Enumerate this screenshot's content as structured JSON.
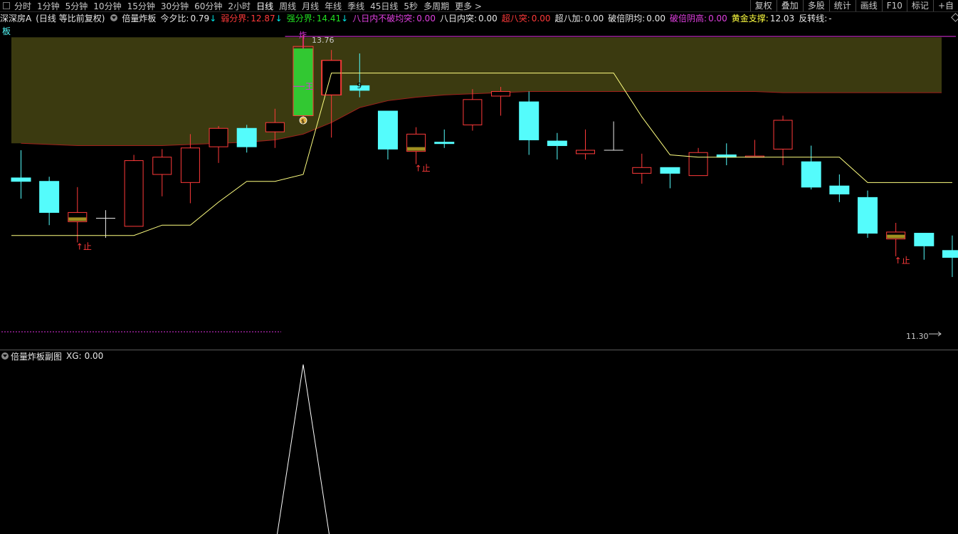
{
  "toolbar": {
    "periods": [
      "分时",
      "1分钟",
      "5分钟",
      "10分钟",
      "15分钟",
      "30分钟",
      "60分钟",
      "2小时",
      "日线",
      "周线",
      "月线",
      "年线",
      "季线",
      "45日线",
      "5秒",
      "多周期",
      "更多 >"
    ],
    "active_period": "日线",
    "right_buttons": [
      "复权",
      "叠加",
      "多股",
      "统计",
      "画线",
      "F10",
      "标记",
      "+自"
    ]
  },
  "info_bar": {
    "stock": "深深房A",
    "mode": "(日线 等比前复权)",
    "indicator": "倍量炸板",
    "items": [
      {
        "label": "今夕比:",
        "value": "0.79",
        "arrow": "↓",
        "label_color": "#e8e8e8",
        "value_color": "#e8e8e8",
        "arrow_color": "#00e0e0"
      },
      {
        "label": "弱分界:",
        "value": "12.87",
        "arrow": "↓",
        "label_color": "#ff3a3a",
        "value_color": "#ff3a3a",
        "arrow_color": "#00e0e0"
      },
      {
        "label": "强分界:",
        "value": "14.41",
        "arrow": "↓",
        "label_color": "#21e021",
        "value_color": "#21e021",
        "arrow_color": "#00e0e0"
      },
      {
        "label": "八日内不破均突:",
        "value": "0.00",
        "arrow": "",
        "label_color": "#e040e0",
        "value_color": "#e040e0",
        "arrow_color": ""
      },
      {
        "label": "八日内突:",
        "value": "0.00",
        "arrow": "",
        "label_color": "#e8e8e8",
        "value_color": "#e8e8e8",
        "arrow_color": ""
      },
      {
        "label": "超八突:",
        "value": "0.00",
        "arrow": "",
        "label_color": "#ff3a3a",
        "value_color": "#ff3a3a",
        "arrow_color": ""
      },
      {
        "label": "超八加:",
        "value": "0.00",
        "arrow": "",
        "label_color": "#e8e8e8",
        "value_color": "#e8e8e8",
        "arrow_color": ""
      },
      {
        "label": "破倍阴均:",
        "value": "0.00",
        "arrow": "",
        "label_color": "#e8e8e8",
        "value_color": "#e8e8e8",
        "arrow_color": ""
      },
      {
        "label": "破倍阴高:",
        "value": "0.00",
        "arrow": "",
        "label_color": "#e040e0",
        "value_color": "#e040e0",
        "arrow_color": ""
      },
      {
        "label": "黄金支撑:",
        "value": "12.03",
        "arrow": "",
        "label_color": "#ffff40",
        "value_color": "#e8e8e8",
        "arrow_color": ""
      },
      {
        "label": "反转线:",
        "value": "-",
        "arrow": "",
        "label_color": "#e8e8e8",
        "value_color": "#e8e8e8",
        "arrow_color": ""
      }
    ]
  },
  "main_chart": {
    "corner_label": "板",
    "high_label": "13.76",
    "low_label": "11.30",
    "candle_marker": "9",
    "stop_label": "止",
    "king_label": "王",
    "rocket_label": "炸",
    "coin_label": "$",
    "colors": {
      "up": "#ff3a3a",
      "down": "#54fcfc",
      "limit": "#32c832",
      "zone": "#3b3a10",
      "zone_edge": "#a0201c",
      "support_line": "#ffff80",
      "purple": "#e030e0"
    },
    "candles": [
      {
        "o": 12.52,
        "h": 12.76,
        "l": 12.34,
        "c": 12.49
      },
      {
        "o": 12.49,
        "h": 12.53,
        "l": 12.11,
        "c": 12.22
      },
      {
        "o": 12.14,
        "h": 12.44,
        "l": 11.96,
        "c": 12.22,
        "stop": true
      },
      {
        "o": 12.17,
        "h": 12.24,
        "l": 12.0,
        "c": 12.17
      },
      {
        "o": 12.1,
        "h": 12.72,
        "l": 12.1,
        "c": 12.67
      },
      {
        "o": 12.55,
        "h": 12.77,
        "l": 12.36,
        "c": 12.7
      },
      {
        "o": 12.48,
        "h": 12.9,
        "l": 12.3,
        "c": 12.78
      },
      {
        "o": 12.79,
        "h": 12.97,
        "l": 12.65,
        "c": 12.95
      },
      {
        "o": 12.95,
        "h": 12.98,
        "l": 12.74,
        "c": 12.79
      },
      {
        "o": 12.92,
        "h": 13.12,
        "l": 12.78,
        "c": 13.0
      },
      {
        "o": 13.06,
        "h": 13.76,
        "l": 13.05,
        "c": 13.64,
        "limit": true
      },
      {
        "o": 13.24,
        "h": 13.63,
        "l": 12.87,
        "c": 13.54
      },
      {
        "o": 13.32,
        "h": 13.6,
        "l": 13.22,
        "c": 13.28
      },
      {
        "o": 13.1,
        "h": 13.1,
        "l": 12.68,
        "c": 12.77
      },
      {
        "o": 12.75,
        "h": 12.96,
        "l": 12.64,
        "c": 12.9,
        "stop": true
      },
      {
        "o": 12.83,
        "h": 12.94,
        "l": 12.78,
        "c": 12.82
      },
      {
        "o": 12.98,
        "h": 13.29,
        "l": 12.93,
        "c": 13.2
      },
      {
        "o": 13.23,
        "h": 13.31,
        "l": 13.06,
        "c": 13.27
      },
      {
        "o": 13.18,
        "h": 13.27,
        "l": 12.72,
        "c": 12.85
      },
      {
        "o": 12.84,
        "h": 12.91,
        "l": 12.68,
        "c": 12.8
      },
      {
        "o": 12.73,
        "h": 12.94,
        "l": 12.68,
        "c": 12.76
      },
      {
        "o": 12.76,
        "h": 13.01,
        "l": 12.76,
        "c": 12.76
      },
      {
        "o": 12.56,
        "h": 12.73,
        "l": 12.47,
        "c": 12.61
      },
      {
        "o": 12.61,
        "h": 12.61,
        "l": 12.43,
        "c": 12.56
      },
      {
        "o": 12.54,
        "h": 12.78,
        "l": 12.54,
        "c": 12.74
      },
      {
        "o": 12.72,
        "h": 12.82,
        "l": 12.63,
        "c": 12.7
      },
      {
        "o": 12.7,
        "h": 12.85,
        "l": 12.7,
        "c": 12.71
      },
      {
        "o": 12.77,
        "h": 13.06,
        "l": 12.63,
        "c": 13.02
      },
      {
        "o": 12.66,
        "h": 12.8,
        "l": 12.42,
        "c": 12.44
      },
      {
        "o": 12.45,
        "h": 12.55,
        "l": 12.31,
        "c": 12.38
      },
      {
        "o": 12.35,
        "h": 12.41,
        "l": 12.0,
        "c": 12.04
      },
      {
        "o": 11.99,
        "h": 12.13,
        "l": 11.84,
        "c": 12.05,
        "stop": true
      },
      {
        "o": 12.04,
        "h": 12.04,
        "l": 11.81,
        "c": 11.93
      },
      {
        "o": 11.89,
        "h": 12.02,
        "l": 11.66,
        "c": 11.83
      }
    ],
    "support_line": [
      12.02,
      12.02,
      12.02,
      12.02,
      12.02,
      12.11,
      12.11,
      12.31,
      12.49,
      12.49,
      12.55,
      13.43,
      13.43,
      13.43,
      13.43,
      13.43,
      13.43,
      13.43,
      13.43,
      13.43,
      13.43,
      13.43,
      13.05,
      12.72,
      12.7,
      12.7,
      12.7,
      12.7,
      12.7,
      12.7,
      12.48,
      12.48,
      12.48,
      12.48
    ]
  },
  "sub_chart": {
    "name": "倍量炸板副图",
    "label": "XG:",
    "value": "0.00",
    "signal": [
      0,
      0,
      0,
      0,
      0,
      0,
      0,
      0,
      0,
      0,
      1,
      0,
      0,
      0,
      0,
      0,
      0,
      0,
      0,
      0,
      0,
      0,
      0,
      0,
      0,
      0,
      0,
      0,
      0,
      0,
      0,
      0,
      0,
      0
    ]
  }
}
